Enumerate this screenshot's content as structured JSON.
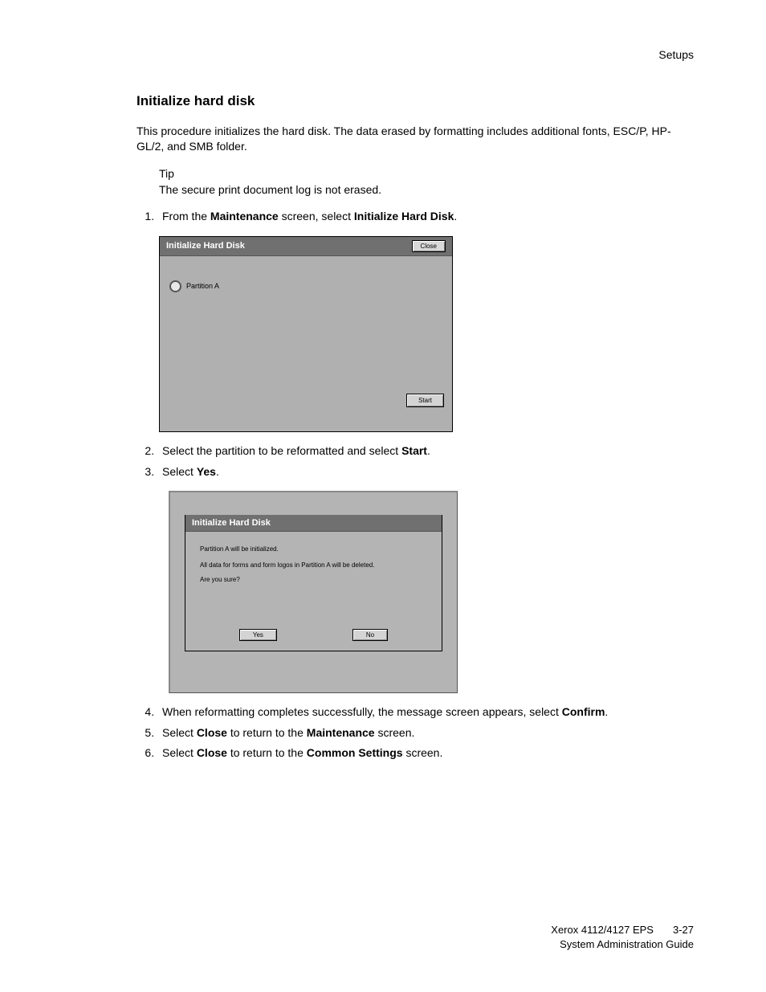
{
  "header": {
    "right": "Setups"
  },
  "section_title": "Initialize hard disk",
  "intro": "This procedure initializes the hard disk.  The data erased by formatting includes additional fonts, ESC/P, HP-GL/2, and SMB folder.",
  "tip": {
    "label": "Tip",
    "text": "The secure print document log is not erased."
  },
  "steps": {
    "s1_a": "From the ",
    "s1_b": "Maintenance",
    "s1_c": " screen, select ",
    "s1_d": "Initialize Hard Disk",
    "s1_e": ".",
    "s2_a": "Select the partition to be reformatted and select ",
    "s2_b": "Start",
    "s2_c": ".",
    "s3_a": "Select ",
    "s3_b": "Yes",
    "s3_c": ".",
    "s4_a": "When reformatting completes successfully, the message screen appears, select ",
    "s4_b": "Confirm",
    "s4_c": ".",
    "s5_a": "Select ",
    "s5_b": "Close",
    "s5_c": " to return to the ",
    "s5_d": "Maintenance",
    "s5_e": " screen.",
    "s6_a": "Select ",
    "s6_b": "Close",
    "s6_c": " to return to the ",
    "s6_d": "Common Settings",
    "s6_e": " screen."
  },
  "dialog1": {
    "title": "Initialize Hard Disk",
    "close": "Close",
    "partition": "Partition A",
    "start": "Start"
  },
  "dialog2": {
    "title": "Initialize Hard Disk",
    "line1": "Partition A will be initialized.",
    "line2": "All data for forms and form logos in Partition A will be deleted.",
    "line3": "Are you sure?",
    "yes": "Yes",
    "no": "No"
  },
  "footer": {
    "product": "Xerox 4112/4127 EPS",
    "page": "3-27",
    "guide": "System Administration Guide"
  }
}
